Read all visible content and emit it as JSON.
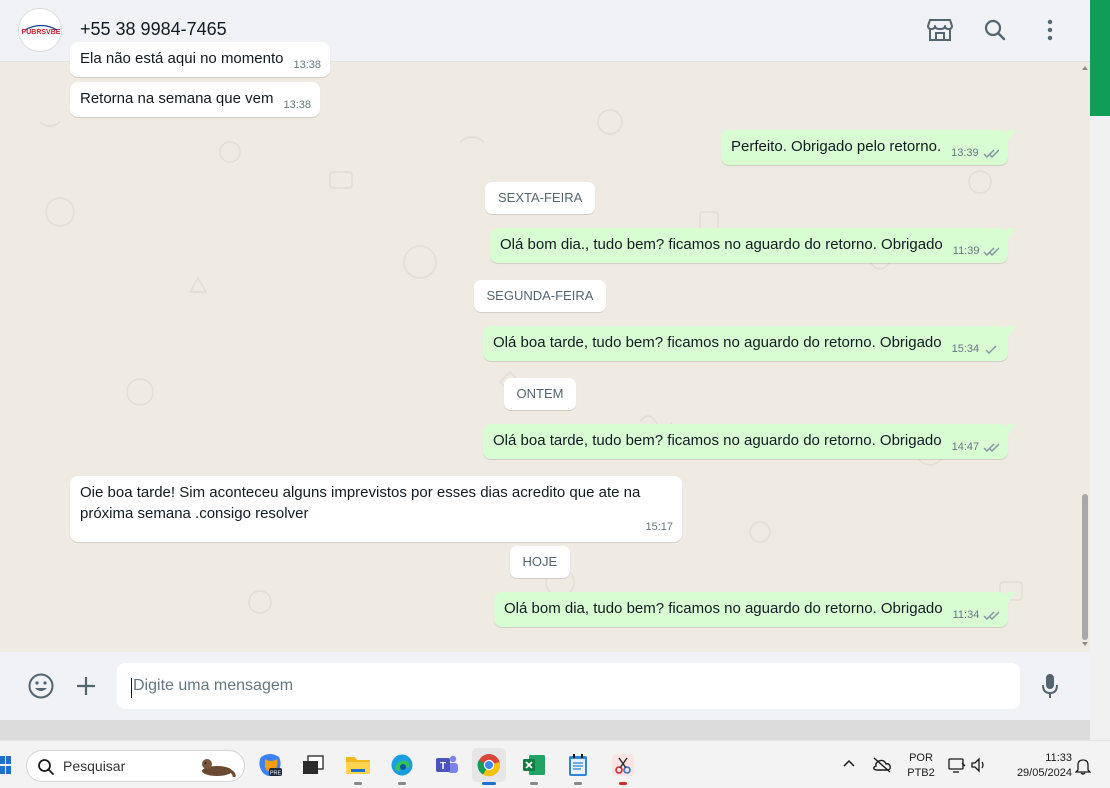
{
  "header": {
    "contact_name": "+55 38 9984-7465",
    "icons": [
      "store-icon",
      "search-icon",
      "more-options-icon"
    ]
  },
  "messages": [
    {
      "dir": "in",
      "text": "Ela não está aqui no momento",
      "time": "13:38"
    },
    {
      "dir": "in",
      "text": "Retorna na semana que vem",
      "time": "13:38"
    },
    {
      "dir": "out",
      "text": "Perfeito. Obrigado pelo retorno.",
      "time": "13:39",
      "status": "read"
    },
    {
      "dir": "date",
      "text": "SEXTA-FEIRA"
    },
    {
      "dir": "out",
      "text": "Olá bom dia., tudo bem? ficamos no aguardo do retorno. Obrigado",
      "time": "11:39",
      "status": "read"
    },
    {
      "dir": "date",
      "text": "SEGUNDA-FEIRA"
    },
    {
      "dir": "out",
      "text": "Olá boa tarde, tudo bem? ficamos no aguardo do retorno. Obrigado",
      "time": "15:34",
      "status": "sent"
    },
    {
      "dir": "date",
      "text": "ONTEM"
    },
    {
      "dir": "out",
      "text": "Olá boa tarde, tudo bem? ficamos no aguardo do retorno. Obrigado",
      "time": "14:47",
      "status": "read"
    },
    {
      "dir": "in",
      "text": "Oie boa tarde! Sim aconteceu alguns imprevistos por esses dias acredito que ate na próxima semana .consigo resolver",
      "time": "15:17"
    },
    {
      "dir": "date",
      "text": "HOJE"
    },
    {
      "dir": "out",
      "text": "Olá bom dia, tudo bem? ficamos no aguardo do retorno. Obrigado",
      "time": "11:34",
      "status": "read"
    }
  ],
  "composer": {
    "placeholder": "Digite uma mensagem",
    "icons": [
      "emoji-icon",
      "plus-icon",
      "microphone-icon"
    ]
  },
  "taskbar": {
    "search_label": "Pesquisar",
    "apps": [
      "copilot",
      "task-view",
      "file-explorer",
      "edge",
      "teams",
      "chrome",
      "excel",
      "notepad",
      "snipping-tool"
    ],
    "active_app": "chrome",
    "language_line1": "POR",
    "language_line2": "PTB2",
    "time": "11:33",
    "date": "29/05/2024"
  },
  "colors": {
    "chat_bg": "#efeae2",
    "bubble_out": "#d9fdd3",
    "bubble_in": "#ffffff",
    "read_tick": "#53bdeb",
    "scrollbar_accent": "#0f9d58"
  }
}
